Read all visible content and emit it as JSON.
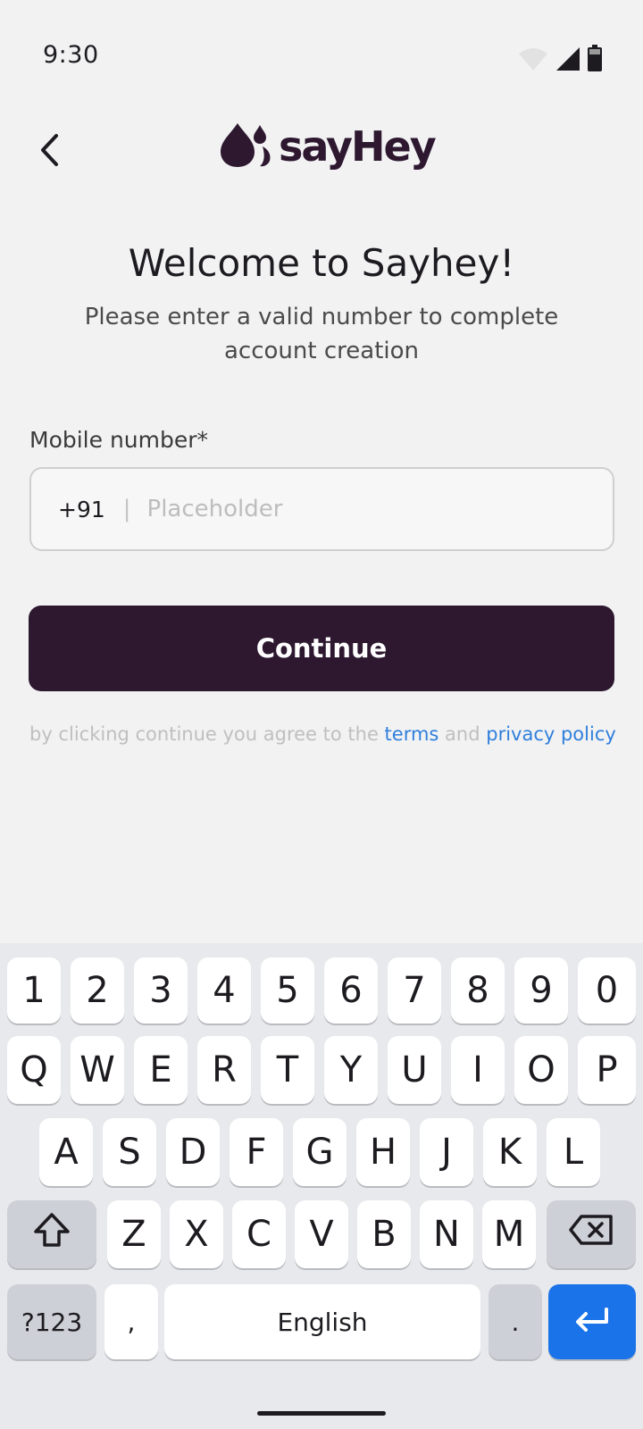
{
  "status": {
    "time": "9:30"
  },
  "brand": {
    "name": "sayHey"
  },
  "welcome": {
    "title": "Welcome to Sayhey!",
    "subtitle": "Please enter a valid number to complete account creation"
  },
  "mobile": {
    "label": "Mobile number*",
    "prefix": "+91",
    "separator": "|",
    "placeholder": "Placeholder",
    "value": ""
  },
  "continue_label": "Continue",
  "terms": {
    "prefix": "by clicking continue you agree to the ",
    "terms_link": "terms",
    "connector": " and ",
    "privacy_link": "privacy policy"
  },
  "colors": {
    "brand": "#2d1830",
    "link": "#2f7fdc",
    "enter_key": "#1a73e8"
  },
  "keyboard": {
    "number_row": [
      "1",
      "2",
      "3",
      "4",
      "5",
      "6",
      "7",
      "8",
      "9",
      "0"
    ],
    "row1": [
      "Q",
      "W",
      "E",
      "R",
      "T",
      "Y",
      "U",
      "I",
      "O",
      "P"
    ],
    "row2": [
      "A",
      "S",
      "D",
      "F",
      "G",
      "H",
      "J",
      "K",
      "L"
    ],
    "row3": [
      "Z",
      "X",
      "C",
      "V",
      "B",
      "N",
      "M"
    ],
    "symbols_label": "?123",
    "comma": ",",
    "space_label": "English",
    "period": ".",
    "icons": [
      "shift-icon",
      "backspace-icon",
      "enter-icon"
    ]
  }
}
